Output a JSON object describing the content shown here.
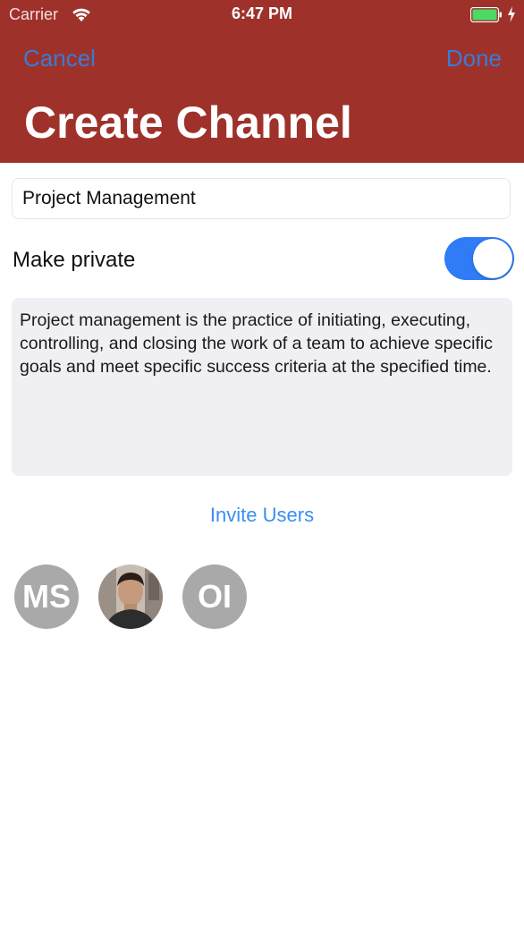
{
  "status_bar": {
    "carrier": "Carrier",
    "time": "6:47 PM"
  },
  "nav": {
    "cancel_label": "Cancel",
    "done_label": "Done",
    "title": "Create Channel"
  },
  "form": {
    "channel_name": "Project Management",
    "private_label": "Make private",
    "private_enabled": true,
    "description": "Project management is the practice of initiating, executing, controlling, and closing the work of a team to achieve specific goals and meet specific success criteria at the specified time.",
    "invite_label": "Invite Users"
  },
  "invited_users": [
    {
      "type": "initials",
      "initials": "MS"
    },
    {
      "type": "photo",
      "initials": ""
    },
    {
      "type": "initials",
      "initials": "OI"
    }
  ],
  "colors": {
    "header": "#9e322b",
    "nav_button": "#3a7bd5",
    "toggle_on": "#2f7cf6",
    "invite_link": "#3a8ef0",
    "avatar_placeholder": "#a9a9a9",
    "battery": "#4cd964"
  },
  "icons": [
    "wifi-icon",
    "battery-icon",
    "charging-bolt-icon"
  ]
}
